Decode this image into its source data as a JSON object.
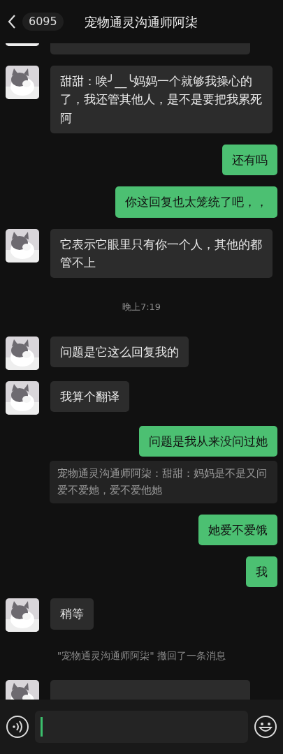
{
  "header": {
    "back_count": "6095",
    "title": "宠物通灵沟通师阿柒"
  },
  "messages": [
    {
      "kind": "stub"
    },
    {
      "kind": "incoming",
      "text": "甜甜：唉╯__╰妈妈一个就够我操心的了，我还管其他人，是不是要把我累死阿"
    },
    {
      "kind": "outgoing",
      "text": "还有吗"
    },
    {
      "kind": "outgoing",
      "text": "你这回复也太笼统了吧，，"
    },
    {
      "kind": "incoming",
      "text": "它表示它眼里只有你一个人，其他的都管不上"
    },
    {
      "kind": "time",
      "text": "晚上7:19"
    },
    {
      "kind": "incoming",
      "text": "问题是它这么回复我的"
    },
    {
      "kind": "incoming",
      "text": "我算个翻译"
    },
    {
      "kind": "outgoing",
      "text": "问题是我从来没问过她"
    },
    {
      "kind": "quote",
      "text": "宠物通灵沟通师阿柒：甜甜：妈妈是不是又问爱不爱她，爱不爱他她"
    },
    {
      "kind": "outgoing",
      "text": "她爱不爱饿"
    },
    {
      "kind": "outgoing",
      "text": "我"
    },
    {
      "kind": "incoming",
      "text": "稍等"
    },
    {
      "kind": "recall",
      "text": "\"宠物通灵沟通师阿柒\" 撤回了一条消息"
    },
    {
      "kind": "partial"
    }
  ]
}
